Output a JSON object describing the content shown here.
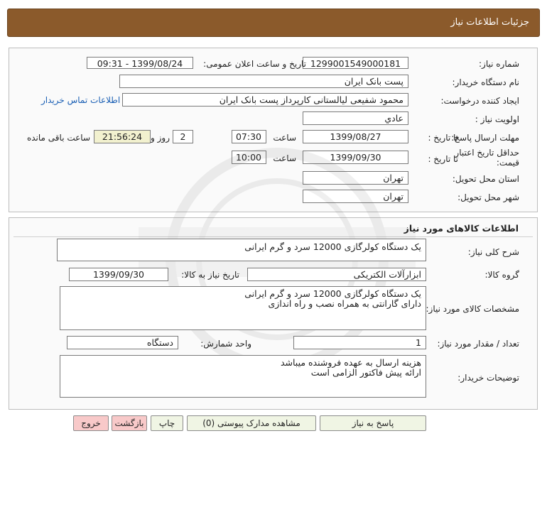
{
  "header": {
    "title": "جزئیات اطلاعات نیاز"
  },
  "details": {
    "need_number_label": "شماره نیاز:",
    "need_number": "1299001549000181",
    "announce_label": "تاریخ و ساعت اعلان عمومی:",
    "announce_value": "1399/08/24 - 09:31",
    "buyer_org_label": "نام دستگاه خریدار:",
    "buyer_org": "پست بانک ایران",
    "requester_label": "ایجاد کننده درخواست:",
    "requester": "محمود شفیعی لیالستانی کارپرداز پست بانک ایران",
    "contact_link": "اطلاعات تماس خریدار",
    "priority_label": "اولویت نیاز :",
    "priority": "عادي",
    "deadline_label": "مهلت ارسال پاسخ:",
    "to_date_label": "تا تاریخ :",
    "deadline_date": "1399/08/27",
    "time_label": "ساعت",
    "deadline_time": "07:30",
    "days_value": "2",
    "days_label": "روز و",
    "remaining_time": "21:56:24",
    "remaining_label": "ساعت باقی مانده",
    "validity_label": "حداقل تاریخ اعتبار قیمت:",
    "validity_to_label": "تا تاریخ :",
    "validity_date": "1399/09/30",
    "validity_time_label": "ساعت",
    "validity_time": "10:00",
    "province_label": "استان محل تحویل:",
    "province": "تهران",
    "city_label": "شهر محل تحویل:",
    "city": "تهران"
  },
  "goods": {
    "section_title": "اطلاعات کالاهای مورد نیاز",
    "summary_label": "شرح کلی نیاز:",
    "summary": "یک دستگاه کولرگازی 12000 سرد و گرم ایرانی",
    "group_label": "گروه کالا:",
    "group": "ابزارآلات الکتریکی",
    "need_date_label": "تاریخ نیاز به کالا:",
    "need_date": "1399/09/30",
    "specs_label": "مشخصات کالای مورد نیاز:",
    "specs": "یک دستگاه کولرگازی 12000 سرد و گرم ایرانی\nدارای گارانتی به همراه نصب و راه اندازی",
    "qty_label": "تعداد / مقدار مورد نیاز:",
    "qty": "1",
    "unit_label": "واحد شمارش:",
    "unit": "دستگاه",
    "buyer_notes_label": "توضیحات خریدار:",
    "buyer_notes": "هزینه ارسال به عهده فروشنده میباشد\nارائه پیش فاکتور الزامی است"
  },
  "buttons": {
    "reply": "پاسخ به نیاز",
    "attachments": "مشاهده مدارک پیوستی (0)",
    "print": "چاپ",
    "back": "بازگشت",
    "exit": "خروج"
  }
}
